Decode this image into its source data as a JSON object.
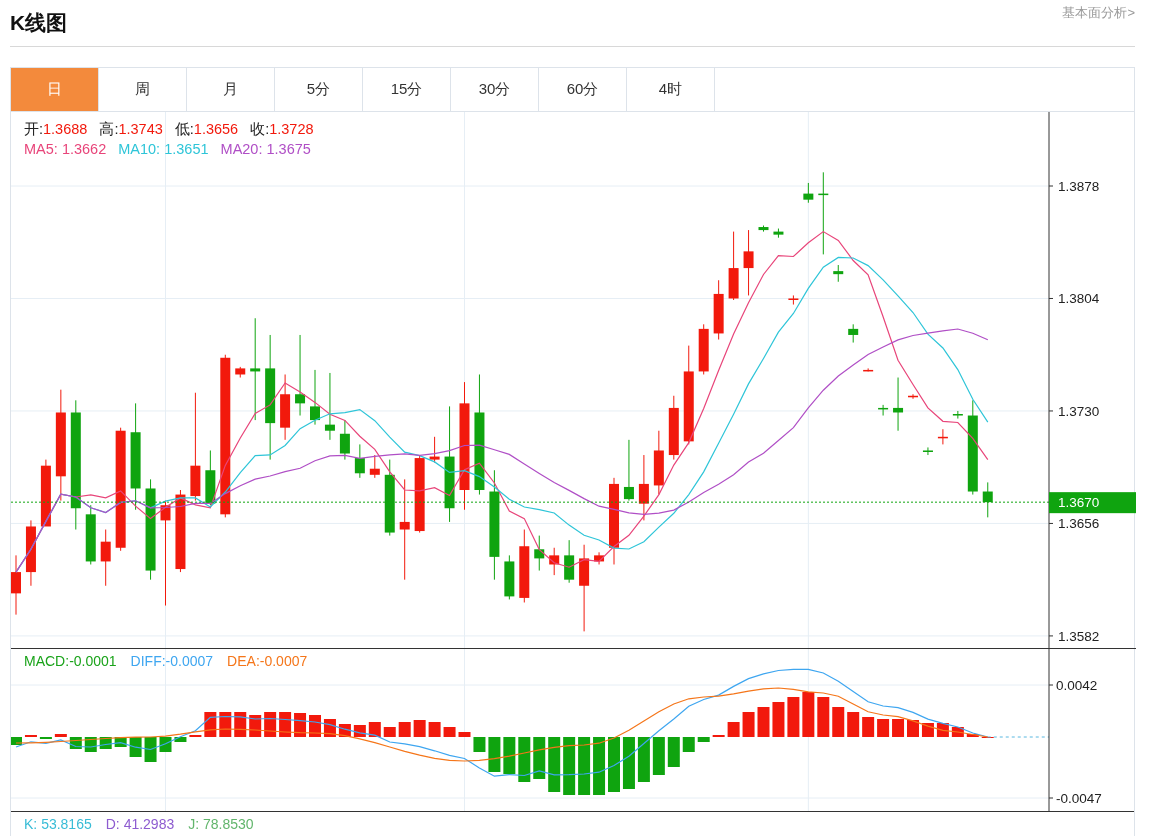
{
  "header": {
    "title": "K线图",
    "link": "基本面分析>"
  },
  "tabs": [
    {
      "label": "日",
      "selected": true
    },
    {
      "label": "周",
      "selected": false
    },
    {
      "label": "月",
      "selected": false
    },
    {
      "label": "5分",
      "selected": false
    },
    {
      "label": "15分",
      "selected": false
    },
    {
      "label": "30分",
      "selected": false
    },
    {
      "label": "60分",
      "selected": false
    },
    {
      "label": "4时",
      "selected": false
    }
  ],
  "price_panel": {
    "ohlc": [
      {
        "label": "开:",
        "value": "1.3688"
      },
      {
        "label": "高:",
        "value": "1.3743"
      },
      {
        "label": "低:",
        "value": "1.3656"
      },
      {
        "label": "收:",
        "value": "1.3728"
      }
    ],
    "moving_averages": [
      {
        "label": "MA5:",
        "value": "1.3662",
        "color": "#e8457a"
      },
      {
        "label": "MA10:",
        "value": "1.3651",
        "color": "#2ec5d8"
      },
      {
        "label": "MA20:",
        "value": "1.3675",
        "color": "#b04fc6"
      }
    ],
    "axis_labels": [
      "1.3878",
      "1.3804",
      "1.3730",
      "1.3656",
      "1.3582"
    ],
    "last_price": "1.3670"
  },
  "macd_panel": {
    "legend": [
      {
        "label": "MACD:",
        "value": "-0.0001",
        "color": "#1aa31a"
      },
      {
        "label": "DIFF:",
        "value": "-0.0007",
        "color": "#3ea6f0"
      },
      {
        "label": "DEA:",
        "value": "-0.0007",
        "color": "#f5761a"
      }
    ],
    "axis_labels": [
      "0.0042",
      "-0.0047"
    ]
  },
  "kdj_panel": {
    "legend": [
      {
        "label": "K:",
        "value": "53.8165",
        "color": "#38bcd6"
      },
      {
        "label": "D:",
        "value": "41.2983",
        "color": "#8e5cd0"
      },
      {
        "label": "J:",
        "value": "78.8530",
        "color": "#62b56c"
      }
    ]
  }
}
